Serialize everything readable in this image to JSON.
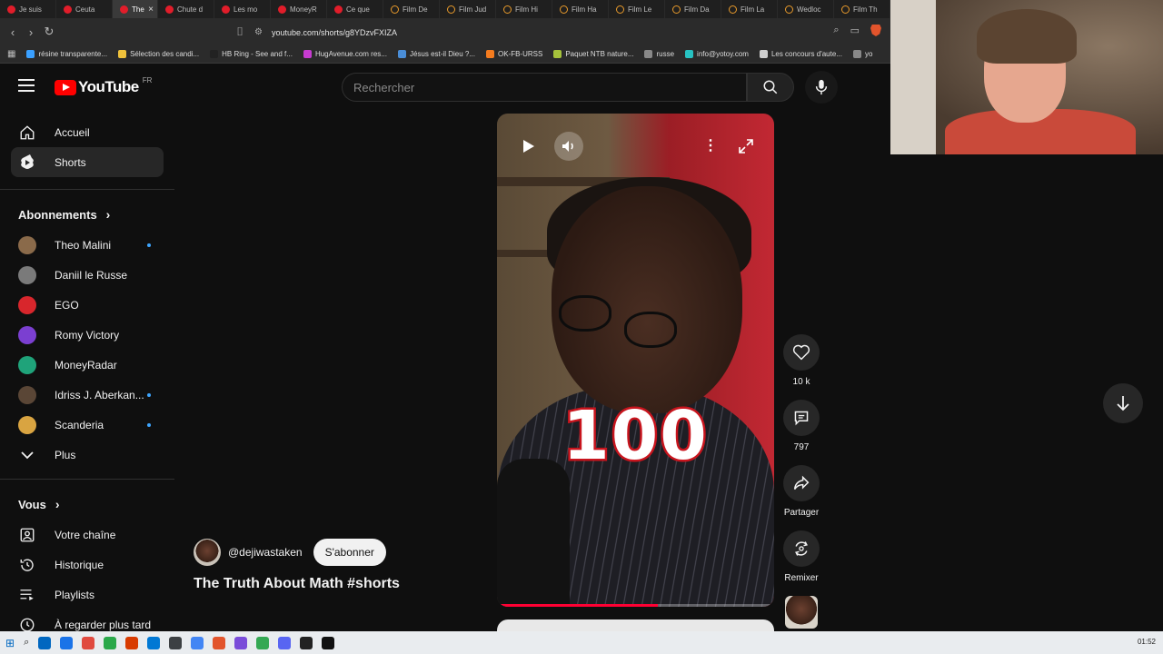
{
  "browser": {
    "tabs": [
      {
        "label": "Je suis",
        "kind": "yt"
      },
      {
        "label": "Ceuta",
        "kind": "yt"
      },
      {
        "label": "The",
        "kind": "yt",
        "active": true
      },
      {
        "label": "Chute d",
        "kind": "yt"
      },
      {
        "label": "Les mo",
        "kind": "yt"
      },
      {
        "label": "MoneyR",
        "kind": "yt"
      },
      {
        "label": "Ce que",
        "kind": "yt"
      },
      {
        "label": "Film De",
        "kind": "film"
      },
      {
        "label": "Film Jud",
        "kind": "film"
      },
      {
        "label": "Film Hi",
        "kind": "film"
      },
      {
        "label": "Film Ha",
        "kind": "film"
      },
      {
        "label": "Film Le",
        "kind": "film"
      },
      {
        "label": "Film Da",
        "kind": "film"
      },
      {
        "label": "Film La",
        "kind": "film"
      },
      {
        "label": "Wedloc",
        "kind": "film"
      },
      {
        "label": "Film Th",
        "kind": "film"
      }
    ],
    "active_tab_close": "×",
    "url": "youtube.com/shorts/g8YDzvFXIZA",
    "bookmarks": [
      "résine transparente...",
      "Sélection des candi...",
      "HB Ring - See and f...",
      "HugAvenue.com res...",
      "Jésus est-il Dieu ?...",
      "OK-FB-URSS",
      "Paquet NTB nature...",
      "russe",
      "info@yotoy.com",
      "Les concours d'aute...",
      "yo"
    ]
  },
  "youtube": {
    "logo_text": "YouTube",
    "region": "FR",
    "search_placeholder": "Rechercher",
    "sidebar": {
      "home": "Accueil",
      "shorts": "Shorts",
      "subscriptions_title": "Abonnements",
      "subscriptions": [
        {
          "name": "Theo Malini",
          "new": true,
          "color": "#8a6a4a"
        },
        {
          "name": "Daniil le Russe",
          "new": false,
          "color": "#7a7a7a"
        },
        {
          "name": "EGO",
          "new": false,
          "color": "#d8262c"
        },
        {
          "name": "Romy Victory",
          "new": false,
          "color": "#7b3fd1"
        },
        {
          "name": "MoneyRadar",
          "new": false,
          "color": "#1fa37a"
        },
        {
          "name": "Idriss J. Aberkan...",
          "new": true,
          "color": "#5a4636"
        },
        {
          "name": "Scanderia",
          "new": true,
          "color": "#d9a441"
        }
      ],
      "more": "Plus",
      "you_title": "Vous",
      "you_items": [
        "Votre chaîne",
        "Historique",
        "Playlists",
        "À regarder plus tard"
      ]
    },
    "short": {
      "caption": "100",
      "progress": 0.58,
      "channel": "@dejiwastaken",
      "subscribe": "S'abonner",
      "title": "The Truth About Math #shorts",
      "likes": "10 k",
      "comments": "797",
      "share": "Partager",
      "remix": "Remixer"
    }
  },
  "taskbar": {
    "clock": "01:52",
    "icons": [
      "#0067c0",
      "#1a73e8",
      "#e04a3f",
      "#2aa84a",
      "#d83b01",
      "#0078d4",
      "#3c4043",
      "#4285f4",
      "#e2542c",
      "#7a4cd9",
      "#34a853",
      "#5865f2",
      "#222222",
      "#111111"
    ]
  }
}
